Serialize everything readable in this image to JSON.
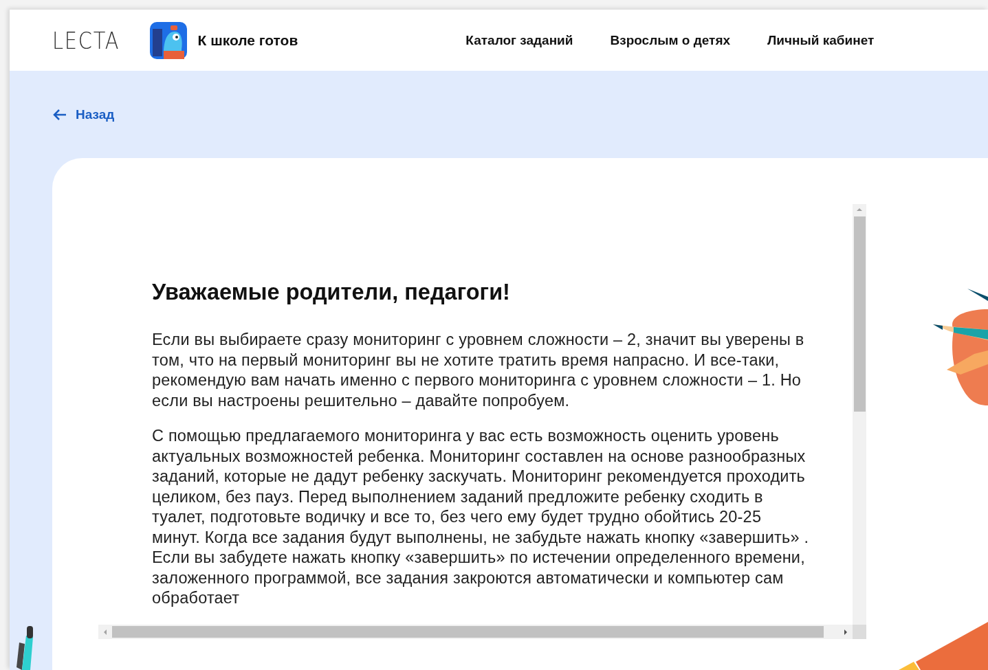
{
  "header": {
    "brand": "LECTA",
    "app_title": "К школе готов",
    "nav": [
      "Каталог заданий",
      "Взрослым о детях",
      "Личный кабинет"
    ]
  },
  "back_link": "Назад",
  "article": {
    "title": "Уважаемые родители, педагоги!",
    "paragraphs": [
      "Если вы выбираете сразу мониторинг с уровнем сложности – 2, значит вы уверены в том, что на первый мониторинг вы не хотите тратить время напрасно. И все-таки, рекомендую вам начать именно с первого мониторинга с уровнем сложности – 1. Но если вы настроены решительно – давайте попробуем.",
      "С помощью предлагаемого мониторинга у вас есть возможность оценить уровень актуальных возможностей ребенка. Мониторинг составлен на основе разнообразных заданий, которые не дадут ребенку заскучать. Мониторинг рекомендуется проходить целиком, без пауз. Перед выполнением заданий предложите ребенку сходить в туалет, подготовьте водичку и все то, без чего ему будет трудно обойтись 20-25 минут. Когда все задания будут выполнены, не забудьте нажать кнопку «завершить» . Если вы забудете нажать кнопку «завершить» по истечении определенного времени, заложенного программой, все задания закроются автоматически и компьютер сам обработает"
    ]
  }
}
